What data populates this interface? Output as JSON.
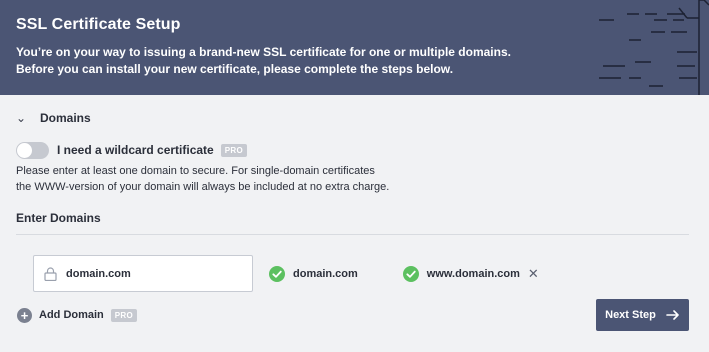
{
  "banner": {
    "title": "SSL Certificate Setup",
    "line1": "You’re on your way to issuing a brand-new SSL certificate for one or multiple domains.",
    "line2": "Before you can install your new certificate, please complete the steps below."
  },
  "section": {
    "title": "Domains",
    "chevron_icon": "chevron-down-icon"
  },
  "wildcard": {
    "label": "I need a wildcard certificate",
    "badge": "PRO",
    "enabled": false
  },
  "info": {
    "line1": "Please enter at least one domain to secure. For single-domain certificates",
    "line2": "the WWW-version of your domain will always be included at no extra charge."
  },
  "enter_domains": {
    "label": "Enter Domains",
    "input_value": "domain.com",
    "lock_icon": "lock-icon"
  },
  "chips": {
    "primary": "domain.com",
    "www": "www.domain.com",
    "check_icon": "check-circle-icon",
    "close_icon": "close-icon"
  },
  "add_domain": {
    "label": "Add Domain",
    "badge": "PRO"
  },
  "next": {
    "label": "Next Step",
    "icon": "arrow-right-icon"
  },
  "colors": {
    "banner_bg": "#4b5574",
    "check_green": "#5cc060",
    "button_bg": "#4b5574",
    "page_bg": "#f1f2f4"
  }
}
